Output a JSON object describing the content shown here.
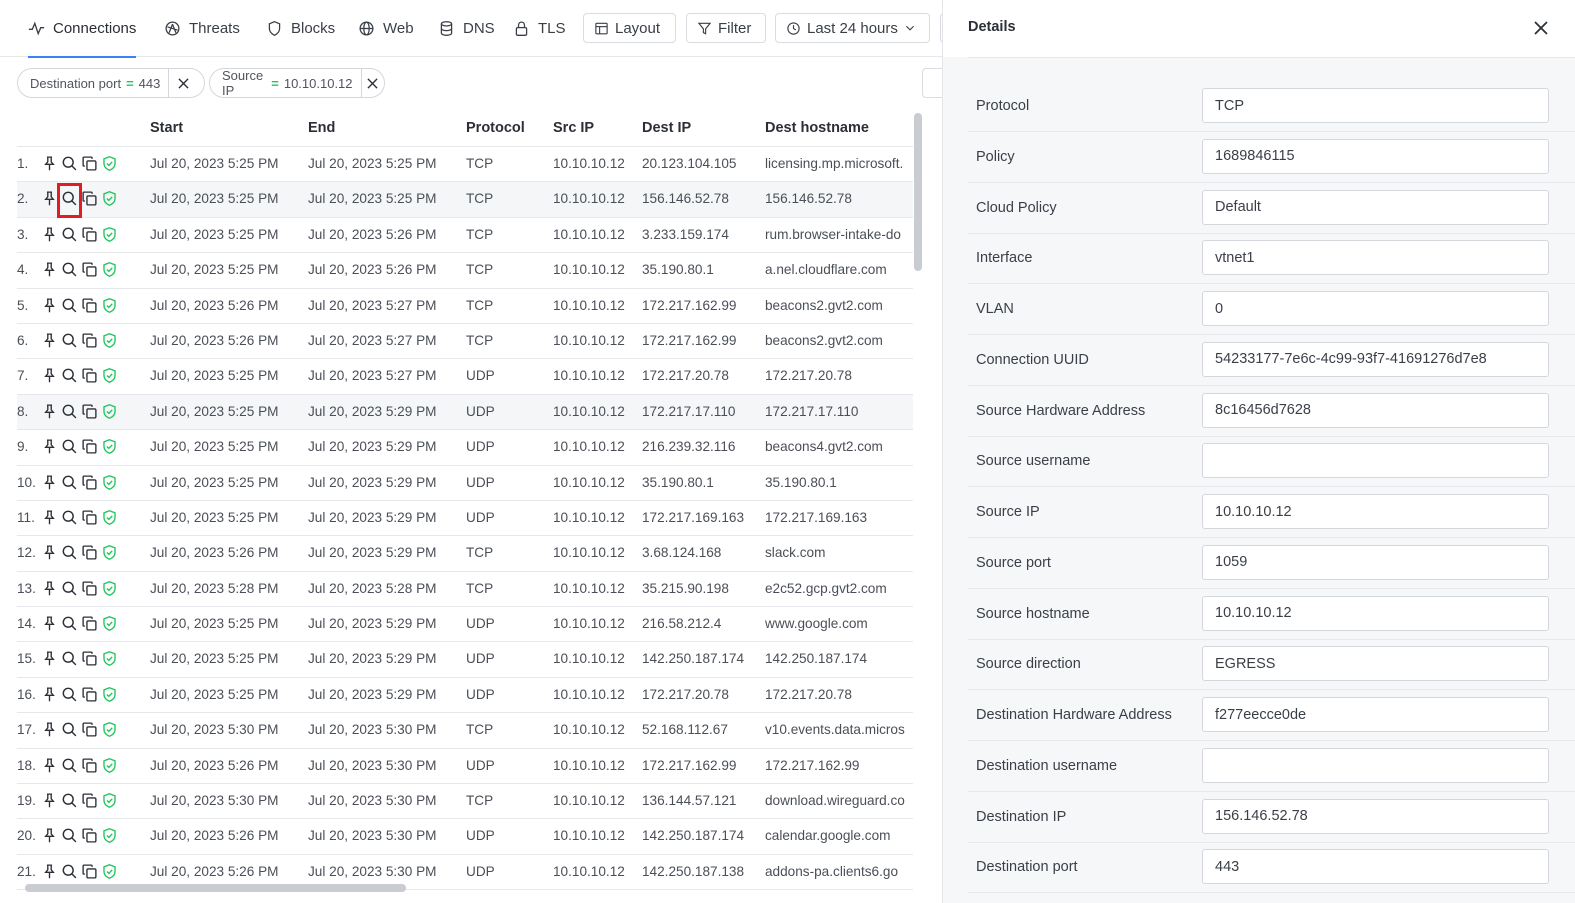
{
  "tabs": [
    {
      "label": "Connections",
      "icon": "activity-icon",
      "active": true
    },
    {
      "label": "Threats",
      "icon": "bug-icon"
    },
    {
      "label": "Blocks",
      "icon": "shield-icon"
    },
    {
      "label": "Web",
      "icon": "globe-icon"
    },
    {
      "label": "DNS",
      "icon": "database-icon"
    },
    {
      "label": "TLS",
      "icon": "lock-icon"
    }
  ],
  "toolbar": {
    "layout_label": "Layout",
    "filter_label": "Filter",
    "time_label": "Last 24 hours"
  },
  "filters": [
    {
      "field": "Destination port",
      "op": "=",
      "value": "443"
    },
    {
      "field": "Source IP",
      "op": "=",
      "value": "10.10.10.12"
    }
  ],
  "table": {
    "columns": [
      "Start",
      "End",
      "Protocol",
      "Src IP",
      "Dest IP",
      "Dest hostname"
    ],
    "highlighted_row": 2,
    "rows": [
      {
        "n": "1.",
        "start": "Jul 20, 2023 5:25 PM",
        "end": "Jul 20, 2023 5:25 PM",
        "proto": "TCP",
        "src": "10.10.10.12",
        "dst": "20.123.104.105",
        "host": "licensing.mp.microsoft."
      },
      {
        "n": "2.",
        "start": "Jul 20, 2023 5:25 PM",
        "end": "Jul 20, 2023 5:25 PM",
        "proto": "TCP",
        "src": "10.10.10.12",
        "dst": "156.146.52.78",
        "host": "156.146.52.78"
      },
      {
        "n": "3.",
        "start": "Jul 20, 2023 5:25 PM",
        "end": "Jul 20, 2023 5:26 PM",
        "proto": "TCP",
        "src": "10.10.10.12",
        "dst": "3.233.159.174",
        "host": "rum.browser-intake-do"
      },
      {
        "n": "4.",
        "start": "Jul 20, 2023 5:25 PM",
        "end": "Jul 20, 2023 5:26 PM",
        "proto": "TCP",
        "src": "10.10.10.12",
        "dst": "35.190.80.1",
        "host": "a.nel.cloudflare.com"
      },
      {
        "n": "5.",
        "start": "Jul 20, 2023 5:26 PM",
        "end": "Jul 20, 2023 5:27 PM",
        "proto": "TCP",
        "src": "10.10.10.12",
        "dst": "172.217.162.99",
        "host": "beacons2.gvt2.com"
      },
      {
        "n": "6.",
        "start": "Jul 20, 2023 5:26 PM",
        "end": "Jul 20, 2023 5:27 PM",
        "proto": "TCP",
        "src": "10.10.10.12",
        "dst": "172.217.162.99",
        "host": "beacons2.gvt2.com"
      },
      {
        "n": "7.",
        "start": "Jul 20, 2023 5:25 PM",
        "end": "Jul 20, 2023 5:27 PM",
        "proto": "UDP",
        "src": "10.10.10.12",
        "dst": "172.217.20.78",
        "host": "172.217.20.78"
      },
      {
        "n": "8.",
        "start": "Jul 20, 2023 5:25 PM",
        "end": "Jul 20, 2023 5:29 PM",
        "proto": "UDP",
        "src": "10.10.10.12",
        "dst": "172.217.17.110",
        "host": "172.217.17.110"
      },
      {
        "n": "9.",
        "start": "Jul 20, 2023 5:25 PM",
        "end": "Jul 20, 2023 5:29 PM",
        "proto": "UDP",
        "src": "10.10.10.12",
        "dst": "216.239.32.116",
        "host": "beacons4.gvt2.com"
      },
      {
        "n": "10.",
        "start": "Jul 20, 2023 5:25 PM",
        "end": "Jul 20, 2023 5:29 PM",
        "proto": "UDP",
        "src": "10.10.10.12",
        "dst": "35.190.80.1",
        "host": "35.190.80.1"
      },
      {
        "n": "11.",
        "start": "Jul 20, 2023 5:25 PM",
        "end": "Jul 20, 2023 5:29 PM",
        "proto": "UDP",
        "src": "10.10.10.12",
        "dst": "172.217.169.163",
        "host": "172.217.169.163"
      },
      {
        "n": "12.",
        "start": "Jul 20, 2023 5:26 PM",
        "end": "Jul 20, 2023 5:29 PM",
        "proto": "TCP",
        "src": "10.10.10.12",
        "dst": "3.68.124.168",
        "host": "slack.com"
      },
      {
        "n": "13.",
        "start": "Jul 20, 2023 5:28 PM",
        "end": "Jul 20, 2023 5:28 PM",
        "proto": "TCP",
        "src": "10.10.10.12",
        "dst": "35.215.90.198",
        "host": "e2c52.gcp.gvt2.com"
      },
      {
        "n": "14.",
        "start": "Jul 20, 2023 5:25 PM",
        "end": "Jul 20, 2023 5:29 PM",
        "proto": "UDP",
        "src": "10.10.10.12",
        "dst": "216.58.212.4",
        "host": "www.google.com"
      },
      {
        "n": "15.",
        "start": "Jul 20, 2023 5:25 PM",
        "end": "Jul 20, 2023 5:29 PM",
        "proto": "UDP",
        "src": "10.10.10.12",
        "dst": "142.250.187.174",
        "host": "142.250.187.174"
      },
      {
        "n": "16.",
        "start": "Jul 20, 2023 5:25 PM",
        "end": "Jul 20, 2023 5:29 PM",
        "proto": "UDP",
        "src": "10.10.10.12",
        "dst": "172.217.20.78",
        "host": "172.217.20.78"
      },
      {
        "n": "17.",
        "start": "Jul 20, 2023 5:30 PM",
        "end": "Jul 20, 2023 5:30 PM",
        "proto": "TCP",
        "src": "10.10.10.12",
        "dst": "52.168.112.67",
        "host": "v10.events.data.micros"
      },
      {
        "n": "18.",
        "start": "Jul 20, 2023 5:26 PM",
        "end": "Jul 20, 2023 5:30 PM",
        "proto": "UDP",
        "src": "10.10.10.12",
        "dst": "172.217.162.99",
        "host": "172.217.162.99"
      },
      {
        "n": "19.",
        "start": "Jul 20, 2023 5:30 PM",
        "end": "Jul 20, 2023 5:30 PM",
        "proto": "TCP",
        "src": "10.10.10.12",
        "dst": "136.144.57.121",
        "host": "download.wireguard.co"
      },
      {
        "n": "20.",
        "start": "Jul 20, 2023 5:26 PM",
        "end": "Jul 20, 2023 5:30 PM",
        "proto": "UDP",
        "src": "10.10.10.12",
        "dst": "142.250.187.174",
        "host": "calendar.google.com"
      },
      {
        "n": "21.",
        "start": "Jul 20, 2023 5:26 PM",
        "end": "Jul 20, 2023 5:30 PM",
        "proto": "UDP",
        "src": "10.10.10.12",
        "dst": "142.250.187.138",
        "host": "addons-pa.clients6.go"
      }
    ]
  },
  "details": {
    "title": "Details",
    "fields": [
      {
        "label": "Protocol",
        "value": "TCP"
      },
      {
        "label": "Policy",
        "value": "1689846115"
      },
      {
        "label": "Cloud Policy",
        "value": "Default"
      },
      {
        "label": "Interface",
        "value": "vtnet1"
      },
      {
        "label": "VLAN",
        "value": "0"
      },
      {
        "label": "Connection UUID",
        "value": "54233177-7e6c-4c99-93f7-41691276d7e8"
      },
      {
        "label": "Source Hardware Address",
        "value": "8c16456d7628"
      },
      {
        "label": "Source username",
        "value": ""
      },
      {
        "label": "Source IP",
        "value": "10.10.10.12"
      },
      {
        "label": "Source port",
        "value": "1059"
      },
      {
        "label": "Source hostname",
        "value": "10.10.10.12"
      },
      {
        "label": "Source direction",
        "value": "EGRESS"
      },
      {
        "label": "Destination Hardware Address",
        "value": "f277eecce0de"
      },
      {
        "label": "Destination username",
        "value": ""
      },
      {
        "label": "Destination IP",
        "value": "156.146.52.78"
      },
      {
        "label": "Destination port",
        "value": "443"
      }
    ]
  },
  "colors": {
    "accent": "#3b82f6",
    "ok": "#22c55e",
    "highlight": "#e11d23"
  }
}
